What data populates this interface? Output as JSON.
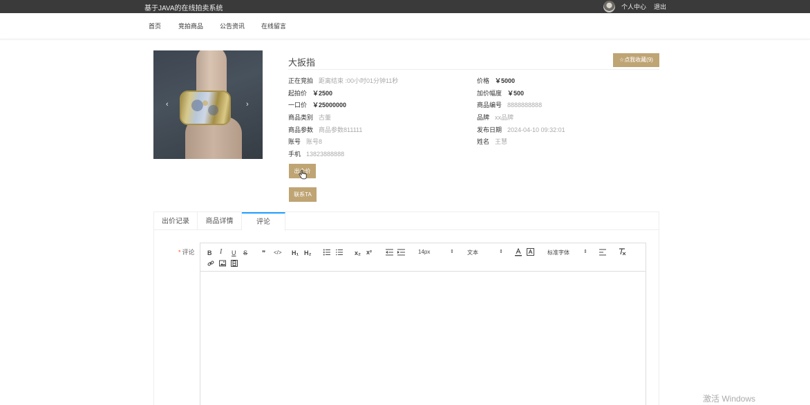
{
  "header": {
    "site_title": "基于JAVA的在线拍卖系统",
    "user_center": "个人中心",
    "logout": "退出"
  },
  "nav": {
    "items": [
      "首页",
      "竞拍商品",
      "公告资讯",
      "在线留言"
    ]
  },
  "product": {
    "name": "大扳指",
    "collect_button": "☆点我收藏(9)",
    "status_label": "正在竞拍",
    "countdown": "距离结束 :00小时01分钟11秒",
    "start_price_label": "起拍价",
    "start_price": "￥2500",
    "buyout_label": "一口价",
    "buyout": "￥25000000",
    "category_label": "商品类别",
    "category": "古董",
    "params_label": "商品参数",
    "params": "商品参数811111",
    "account_label": "账号",
    "account": "账号8",
    "phone_label": "手机",
    "phone": "13823888888",
    "price_label": "价格",
    "price": "￥5000",
    "increment_label": "加价幅度",
    "increment": "￥500",
    "code_label": "商品编号",
    "code": "8888888888",
    "brand_label": "品牌",
    "brand": "xx品牌",
    "date_label": "发布日期",
    "date": "2024-04-10 09:32:01",
    "seller_label": "姓名",
    "seller": "王慧",
    "bid_button": "出个价",
    "contact_button": "联系TA"
  },
  "tabs": [
    "出价记录",
    "商品详情",
    "评论"
  ],
  "active_tab": "评论",
  "comment": {
    "label": "评论",
    "required_mark": "*"
  },
  "editor_toolbar": {
    "bold": "B",
    "italic": "I",
    "underline": "U",
    "strike": "S",
    "quote": "❞",
    "code": "</>",
    "h1": "H₁",
    "h2": "H₂",
    "sub": "x₂",
    "sup": "x²",
    "font_size": "14px",
    "text_style": "文本",
    "font_family": "标准字体"
  },
  "watermark": "激活 Windows",
  "colors": {
    "topbar": "#3a3a3a",
    "accent_button": "#bfa474",
    "active_tab_border": "#1e9fff"
  }
}
